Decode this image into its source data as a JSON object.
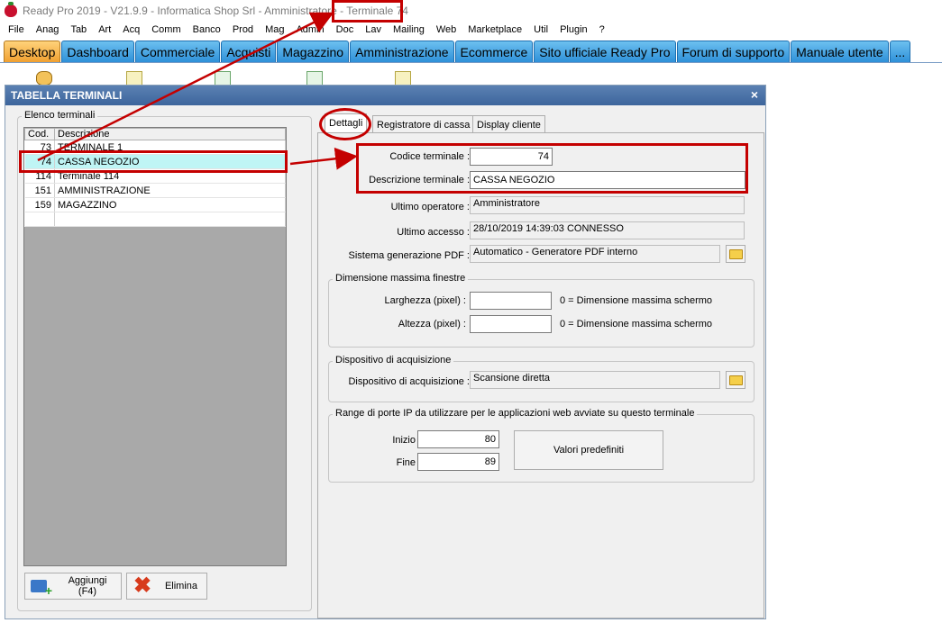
{
  "app": {
    "title": "Ready Pro 2019 - V21.9.9 - Informatica Shop Srl - Amministratore - Terminale 74"
  },
  "menu": [
    "File",
    "Anag",
    "Tab",
    "Art",
    "Acq",
    "Comm",
    "Banco",
    "Prod",
    "Mag",
    "Admin",
    "Doc",
    "Lav",
    "Mailing",
    "Web",
    "Marketplace",
    "Util",
    "Plugin",
    "?"
  ],
  "tabs": [
    "Desktop",
    "Dashboard",
    "Commerciale",
    "Acquisti",
    "Magazzino",
    "Amministrazione",
    "Ecommerce",
    "Sito ufficiale Ready Pro",
    "Forum di supporto",
    "Manuale utente",
    "..."
  ],
  "window": {
    "title": "TABELLA TERMINALI",
    "close": "×",
    "list_group": "Elenco terminali",
    "columns": [
      "Cod.",
      "Descrizione"
    ],
    "rows": [
      {
        "code": "73",
        "desc": "TERMINALE 1"
      },
      {
        "code": "74",
        "desc": "CASSA NEGOZIO"
      },
      {
        "code": "114",
        "desc": "Terminale 114"
      },
      {
        "code": "151",
        "desc": "AMMINISTRAZIONE"
      },
      {
        "code": "159",
        "desc": "MAGAZZINO"
      }
    ],
    "buttons": {
      "add": "Aggiungi (F4)",
      "delete": "Elimina"
    }
  },
  "subtabs": [
    "Dettagli",
    "Registratore di cassa",
    "Display cliente"
  ],
  "details": {
    "codice_label": "Codice terminale :",
    "codice_value": "74",
    "descrizione_label": "Descrizione terminale :",
    "descrizione_value": "CASSA NEGOZIO",
    "operatore_label": "Ultimo operatore :",
    "operatore_value": "Amministratore",
    "accesso_label": "Ultimo accesso :",
    "accesso_value": "28/10/2019  14:39:03  CONNESSO",
    "pdf_label": "Sistema generazione PDF :",
    "pdf_value": "Automatico - Generatore PDF interno",
    "dim_group": "Dimensione massima finestre",
    "larghezza_label": "Larghezza (pixel) :",
    "larghezza_value": "",
    "altezza_label": "Altezza (pixel) :",
    "altezza_value": "",
    "dim_hint": "0 = Dimensione massima schermo",
    "acq_group": "Dispositivo di acquisizione",
    "acq_label": "Dispositivo di acquisizione :",
    "acq_value": "Scansione diretta",
    "porte_group": "Range di porte IP da utilizzare per le applicazioni web avviate su questo terminale",
    "inizio_label": "Inizio",
    "inizio_value": "80",
    "fine_label": "Fine",
    "fine_value": "89",
    "valori_button": "Valori predefiniti"
  },
  "colors": {
    "annotation": "#c40000",
    "selected_row": "#bff5f5",
    "tab_active": "#f0a030",
    "tab_normal": "#2e90d8"
  }
}
